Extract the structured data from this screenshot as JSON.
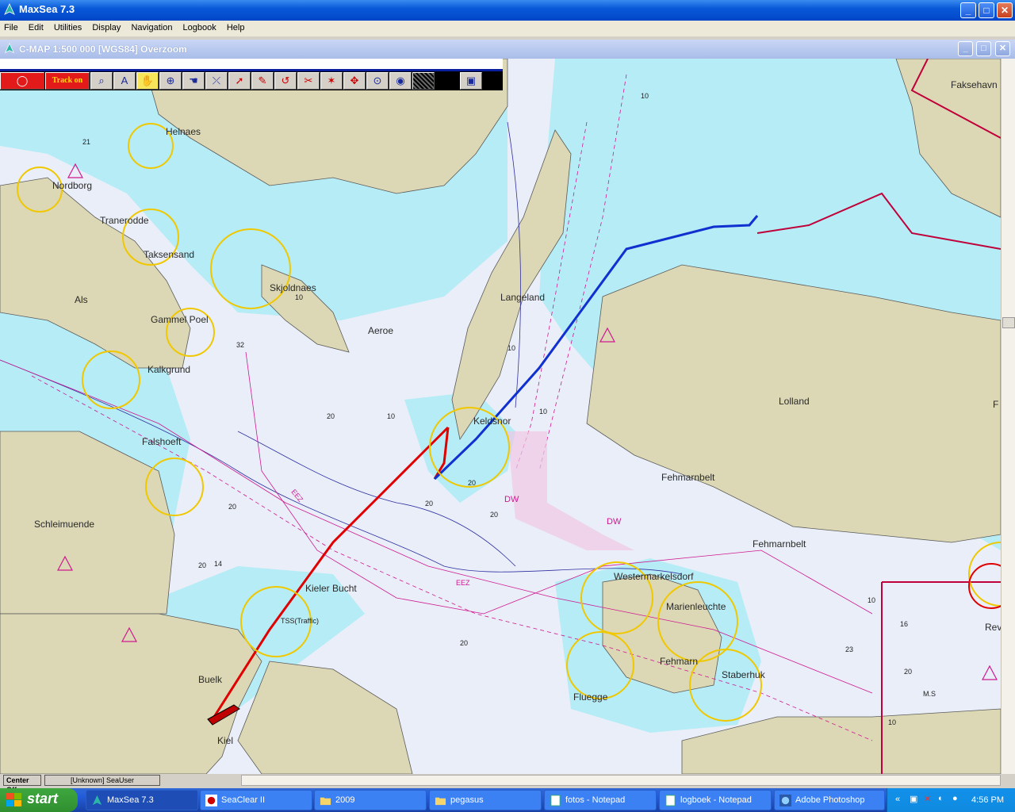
{
  "window": {
    "title": "MaxSea 7.3"
  },
  "menu": [
    "File",
    "Edit",
    "Utilities",
    "Display",
    "Navigation",
    "Logbook",
    "Help"
  ],
  "child": {
    "title": "C-MAP  1:500 000 [WGS84]    Overzoom"
  },
  "toolbar": {
    "track_label": "Track on"
  },
  "places": [
    {
      "name": "Helnaes",
      "key": "helnaes"
    },
    {
      "name": "Nordborg",
      "key": "nordborg"
    },
    {
      "name": "Tranerodde",
      "key": "tranerodde"
    },
    {
      "name": "Taksensand",
      "key": "taksensand"
    },
    {
      "name": "Als",
      "key": "als"
    },
    {
      "name": "Skjoldnaes",
      "key": "skjoldnaes"
    },
    {
      "name": "Gammel Poel",
      "key": "gammel-poel"
    },
    {
      "name": "Aeroe",
      "key": "aeroe"
    },
    {
      "name": "Langeland",
      "key": "langeland"
    },
    {
      "name": "Kalkgrund",
      "key": "kalkgrund"
    },
    {
      "name": "Falshoeft",
      "key": "falshoeft"
    },
    {
      "name": "Keldsnor",
      "key": "keldsnor"
    },
    {
      "name": "Lolland",
      "key": "lolland"
    },
    {
      "name": "Fehmarnbelt",
      "key": "fehmarnbelt-1"
    },
    {
      "name": "Fehmarnbelt",
      "key": "fehmarnbelt-2"
    },
    {
      "name": "Schleimuende",
      "key": "schleimuende"
    },
    {
      "name": "Kieler Bucht",
      "key": "kieler-bucht"
    },
    {
      "name": "Westermarkelsdorf",
      "key": "westermarkelsdorf"
    },
    {
      "name": "Marienleuchte",
      "key": "marienleuchte"
    },
    {
      "name": "Fehmarn",
      "key": "fehmarn"
    },
    {
      "name": "Staberhuk",
      "key": "staberhuk"
    },
    {
      "name": "Fluegge",
      "key": "fluegge"
    },
    {
      "name": "Buelk",
      "key": "buelk"
    },
    {
      "name": "Kiel",
      "key": "kiel"
    },
    {
      "name": "Faksehavn",
      "key": "faksehavn"
    },
    {
      "name": "Rev",
      "key": "rev"
    },
    {
      "name": "F",
      "key": "f"
    }
  ],
  "depths": [
    "21",
    "32",
    "10",
    "20",
    "10",
    "20",
    "20",
    "20",
    "10",
    "10",
    "20",
    "14",
    "20",
    "20",
    "10",
    "10",
    "16",
    "23",
    "10",
    "20"
  ],
  "chart_text": {
    "eez": "EEZ",
    "dw": "DW",
    "traffic": "TSS(Traffic)",
    "ms": "M.S"
  },
  "status": {
    "center": "Center Off",
    "user": "[Unknown] SeaUser"
  },
  "taskbar": {
    "start": "start",
    "tasks": [
      "MaxSea 7.3",
      "SeaClear II",
      "2009",
      "pegasus",
      "fotos - Notepad",
      "logboek - Notepad",
      "Adobe Photoshop"
    ],
    "clock": "4:56 PM"
  },
  "colors": {
    "land": "#dcd7b4",
    "shallow": "#b5ecf6",
    "deep": "#e9eef8",
    "track_red": "#e00000",
    "track_blue": "#1030d0",
    "border": "#c0003a"
  }
}
